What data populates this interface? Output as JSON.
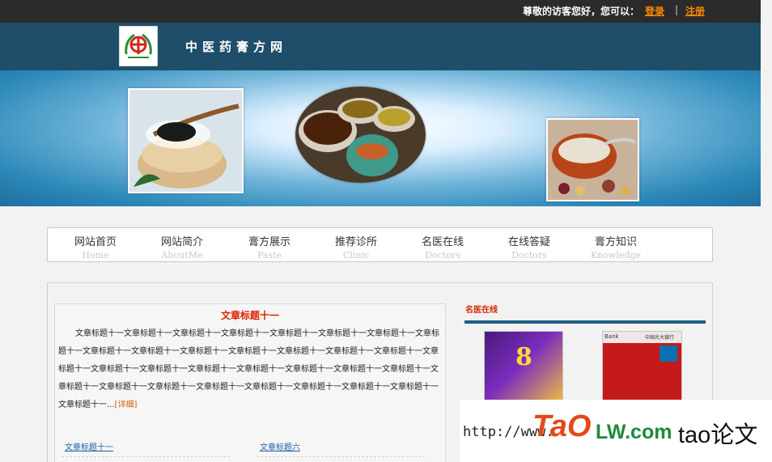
{
  "topbar": {
    "greeting": "尊敬的访客您好，您可以：",
    "login": "登录",
    "separator": "|",
    "register": "注册"
  },
  "header": {
    "site_title": "中医药膏方网"
  },
  "nav": {
    "items": [
      {
        "cn": "网站首页",
        "en": "Home"
      },
      {
        "cn": "网站简介",
        "en": "AboutMe"
      },
      {
        "cn": "膏方展示",
        "en": "Paste"
      },
      {
        "cn": "推荐诊所",
        "en": "Clinic"
      },
      {
        "cn": "名医在线",
        "en": "Doctors"
      },
      {
        "cn": "在线答疑",
        "en": "Doctors"
      },
      {
        "cn": "膏方知识",
        "en": "Knowledge"
      }
    ]
  },
  "article": {
    "title": "文章标题十一",
    "body": "文章标题十一文章标题十一文章标题十一文章标题十一文章标题十一文章标题十一文章标题十一文章标题十一文章标题十一文章标题十一文章标题十一文章标题十一文章标题十一文章标题十一文章标题十一文章标题十一文章标题十一文章标题十一文章标题十一文章标题十一文章标题十一文章标题十一文章标题十一文章标题十一文章标题十一文章标题十一文章标题十一文章标题十一文章标题十一文章标题十一文章标题十一文章标题十一...",
    "more": "[详细]",
    "links": [
      "文章标题十一",
      "文章标题六"
    ]
  },
  "side": {
    "title": "名医在线",
    "doc1_text": "8",
    "doc2_bank": "Bank",
    "doc2_bank_cn": "中国光大银行"
  },
  "watermark": {
    "url": "http://www.",
    "tao": "TaO",
    "lw": "LW.com",
    "cn": "tao论文"
  },
  "colors": {
    "topbar": "#2b2b2b",
    "header": "#1f4e6a",
    "accent_link": "#ff8a00",
    "title_red": "#e02000"
  }
}
